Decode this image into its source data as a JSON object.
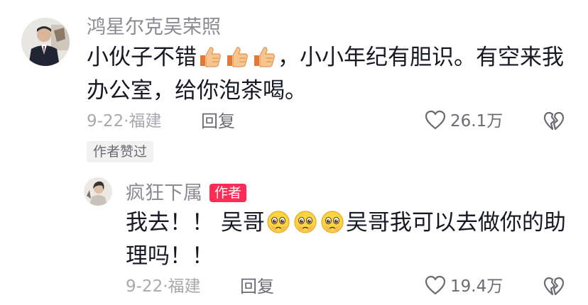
{
  "comment": {
    "username": "鸿星尔克吴荣照",
    "text_part1": "小伙子不错",
    "text_part2": "，小小年纪有胆识。有空来我",
    "text_line2": "办公室，给你泡茶喝。",
    "emoji_name": "thumbs-up-emoji",
    "meta": "9-22·福建",
    "reply_label": "回复",
    "like_count": "26.1万",
    "liked_badge": "作者赞过"
  },
  "reply": {
    "username": "疯狂下属",
    "author_badge": "作者",
    "text_part1": "我去！！ 吴哥",
    "text_part2": "吴哥我可以去做你的助",
    "text_line2": "理吗！！",
    "emoji_name": "pleading-face-emoji",
    "meta": "9-22·福建",
    "reply_label": "回复",
    "like_count": "19.4万"
  },
  "icons": {
    "like": "heart-outline-icon",
    "dislike": "broken-heart-icon"
  },
  "colors": {
    "author_badge": "#fe2c55",
    "username": "#8a8b91",
    "meta": "#a8a9ad"
  }
}
